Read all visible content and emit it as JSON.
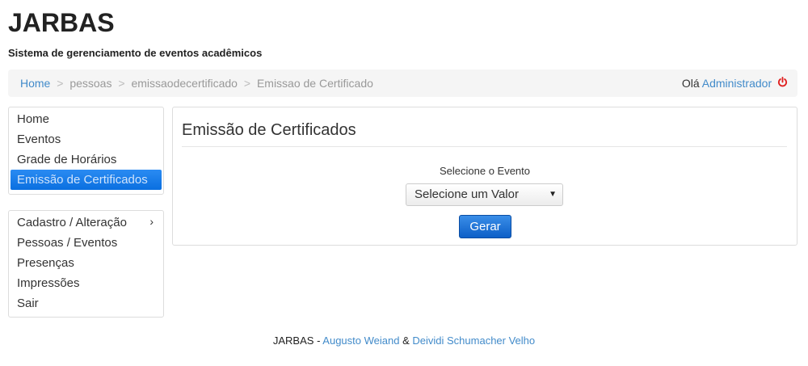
{
  "header": {
    "title": "JARBAS",
    "subtitle": "Sistema de gerenciamento de eventos acadêmicos"
  },
  "breadcrumb": {
    "home": "Home",
    "sep": ">",
    "items": [
      "pessoas",
      "emissaodecertificado",
      "Emissao de Certificado"
    ]
  },
  "user": {
    "greeting": "Olá",
    "name": "Administrador",
    "logout_icon": "power-icon"
  },
  "sidebar": {
    "primary": [
      {
        "label": "Home"
      },
      {
        "label": "Eventos"
      },
      {
        "label": "Grade de Horários"
      },
      {
        "label": "Emissão de Certificados",
        "active": true
      }
    ],
    "secondary": [
      {
        "label": "Cadastro / Alteração",
        "chevron": "›"
      },
      {
        "label": "Pessoas / Eventos"
      },
      {
        "label": "Presenças"
      },
      {
        "label": "Impressões"
      },
      {
        "label": "Sair"
      }
    ]
  },
  "main": {
    "title": "Emissão de Certificados",
    "select_label": "Selecione o Evento",
    "select_value": "Selecione um Valor",
    "select_arrow": "▼",
    "button_label": "Gerar"
  },
  "footer": {
    "brand": "JARBAS",
    "sep1": " - ",
    "author1": "Augusto Weiand",
    "amp": " & ",
    "author2": "Deividi Schumacher Velho"
  },
  "colors": {
    "link": "#428bca",
    "active_item": "#0a6fe0",
    "button": "#0d5fc7",
    "logout": "#e02020"
  }
}
